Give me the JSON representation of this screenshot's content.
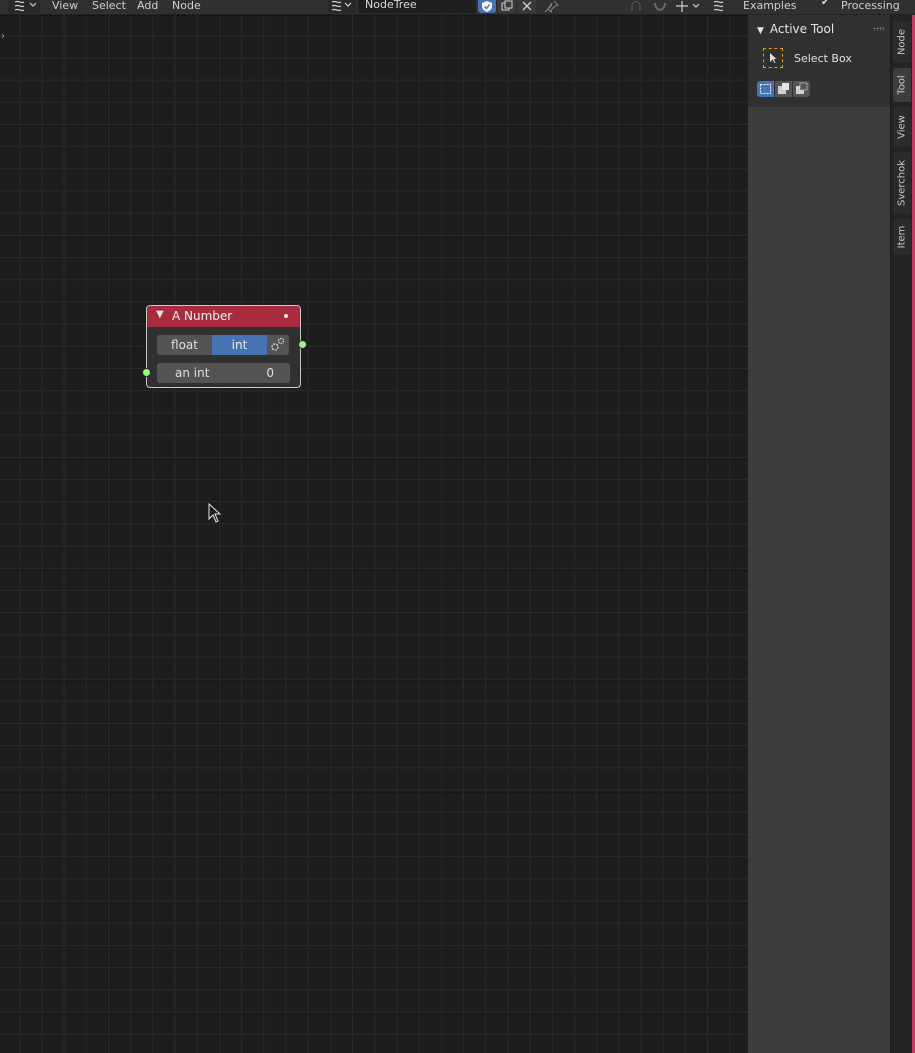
{
  "header": {
    "menus": [
      "View",
      "Select",
      "Add",
      "Node"
    ],
    "tree_name": "NodeTree",
    "examples_label": "Examples",
    "processing_label": "Processing"
  },
  "node": {
    "title": "A Number",
    "toggle_float": "float",
    "toggle_int": "int",
    "field_label": "an int",
    "field_value": "0"
  },
  "sidebar": {
    "panel_title": "Active Tool",
    "tool_name": "Select Box",
    "tabs": [
      "Node",
      "Tool",
      "View",
      "Sverchok",
      "Item"
    ]
  },
  "colors": {
    "node_header": "#a82b3e",
    "accent_blue": "#4772b3",
    "socket_green": "#9ef58a"
  }
}
